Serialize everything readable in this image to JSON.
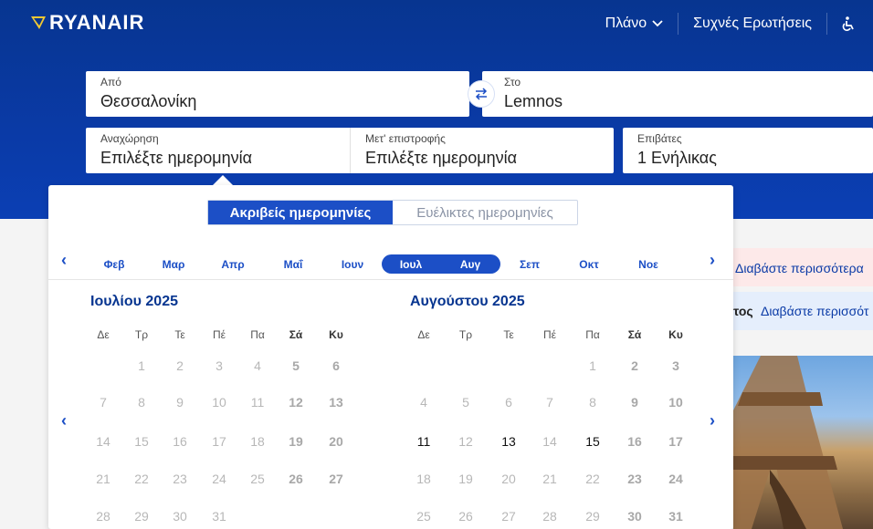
{
  "brand": {
    "name": "RYANAIR"
  },
  "nav": {
    "plan": "Πλάνο",
    "faq": "Συχνές Ερωτήσεις",
    "accessibility_icon": "wheelchair-icon"
  },
  "search": {
    "from": {
      "label": "Από",
      "value": "Θεσσαλονίκη"
    },
    "to": {
      "label": "Στο",
      "value": "Lemnos"
    },
    "depart": {
      "label": "Αναχώρηση",
      "value": "Επιλέξτε ημερομηνία"
    },
    "return": {
      "label": "Μετ' επιστροφής",
      "value": "Επιλέξτε ημερομηνία"
    },
    "passengers": {
      "label": "Επιβάτες",
      "value": "1 Ενήλικας"
    }
  },
  "banners": {
    "red": "Διαβάστε περισσότερα",
    "blue_prefix": "τος",
    "blue": "Διαβάστε περισσότ"
  },
  "calendar": {
    "tabs": {
      "exact": "Ακριβείς ημερομηνίες",
      "flexible": "Ευέλικτες ημερομηνίες"
    },
    "months": [
      "Φεβ",
      "Μαρ",
      "Απρ",
      "Μαΐ",
      "Ιουν",
      "Ιουλ",
      "Αυγ",
      "Σεπ",
      "Οκτ",
      "Νοε"
    ],
    "selected_months": [
      "Ιουλ",
      "Αυγ"
    ],
    "weekdays": [
      "Δε",
      "Τρ",
      "Τε",
      "Πέ",
      "Πα",
      "Σά",
      "Κυ"
    ],
    "left": {
      "title": "Ιουλίου 2025",
      "offset": 1,
      "days": 31,
      "available": []
    },
    "right": {
      "title": "Αυγούστου 2025",
      "offset": 4,
      "days": 31,
      "available": [
        11,
        13,
        15
      ]
    },
    "colors": {
      "accent": "#1c4fc6",
      "hero": "#073590"
    }
  }
}
